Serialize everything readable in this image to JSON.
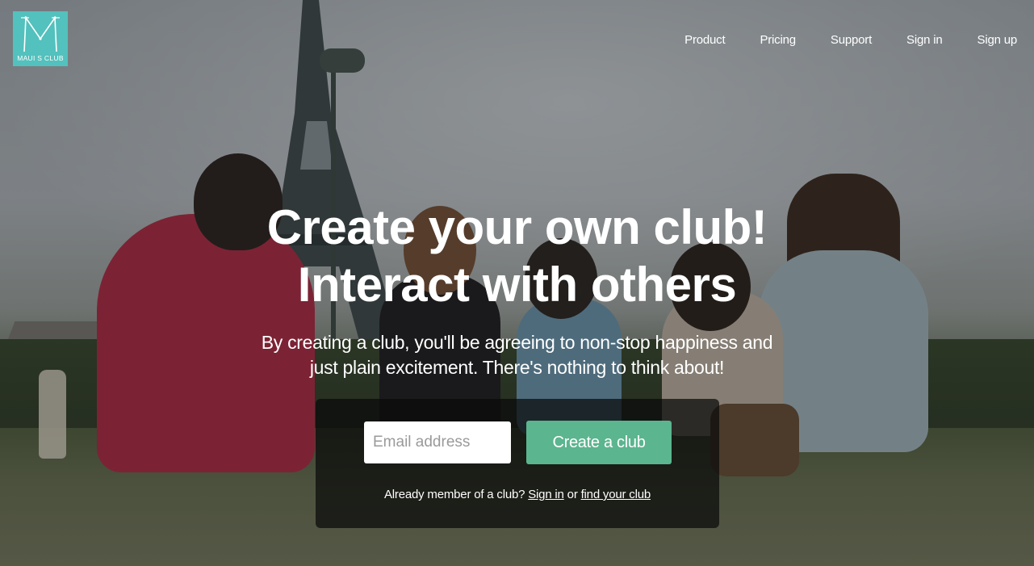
{
  "brand": {
    "logo_text": "MAUI S CLUB",
    "logo_color": "#53c1bd"
  },
  "nav": {
    "items": [
      "Product",
      "Pricing",
      "Support",
      "Sign in",
      "Sign up"
    ]
  },
  "hero": {
    "headline_line1": "Create your own club!",
    "headline_line2": "Interact with others",
    "subtext_line1": "By creating a club, you'll be agreeing to non-stop happiness and",
    "subtext_line2": "just plain excitement. There's nothing to think about!"
  },
  "signup": {
    "email_placeholder": "Email address",
    "email_value": "",
    "button_label": "Create a club",
    "button_color": "#5bb58e",
    "member_prefix": "Already member of a club?",
    "signin_link": "Sign in",
    "or_text": "or",
    "find_link": "find your club"
  }
}
